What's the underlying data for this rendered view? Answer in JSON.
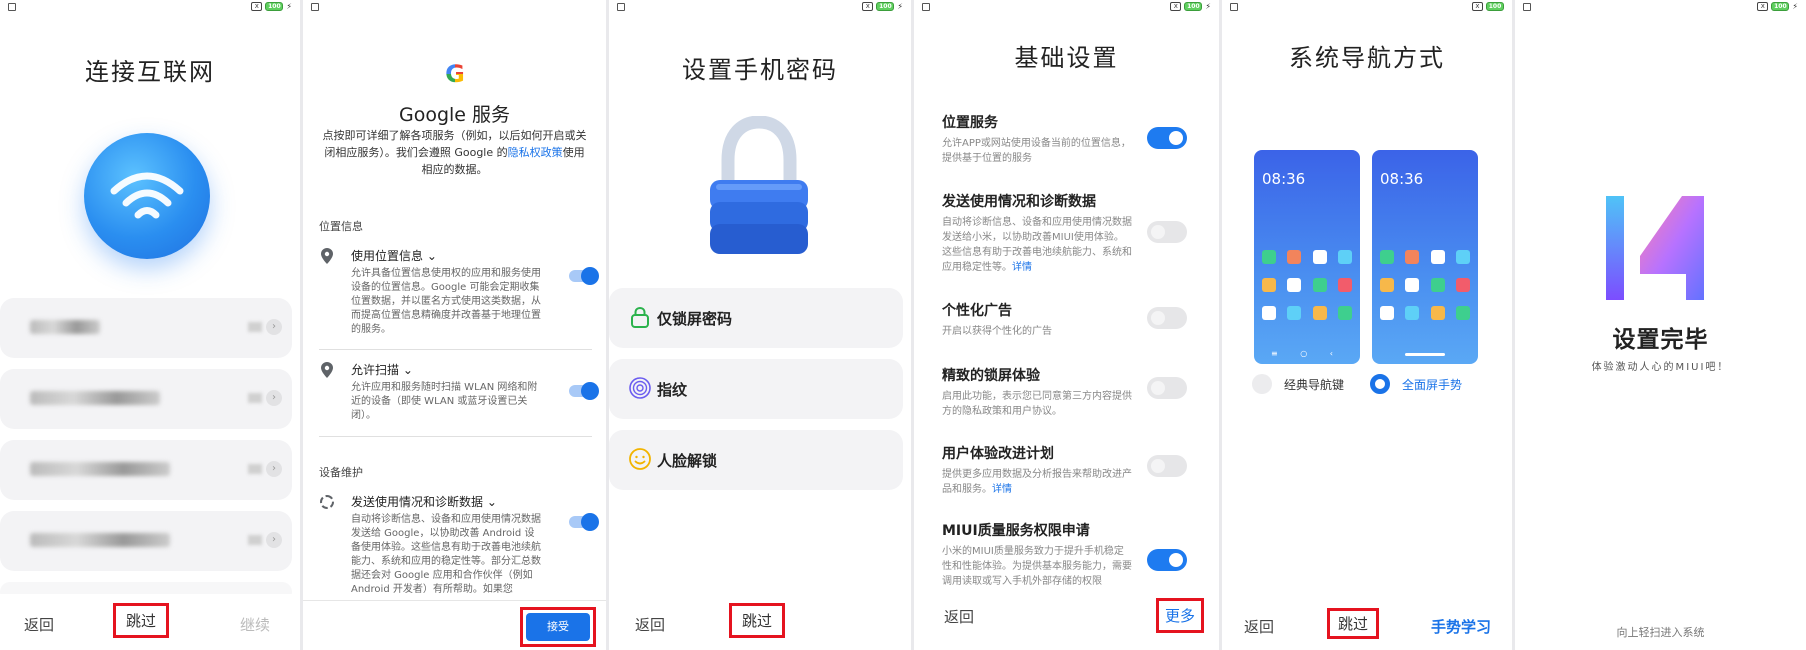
{
  "status": {
    "battery": "100",
    "x_label": "x"
  },
  "wifi_screen": {
    "title": "连接互联网",
    "back": "返回",
    "skip": "跳过",
    "continue": "继续"
  },
  "google_screen": {
    "logo": "G",
    "title": "Google 服务",
    "intro_a": "点按即可详细了解各项服务（例如，以后如何开启或关闭相应服务）。我们会遵照 Google 的",
    "intro_link": "隐私权政策",
    "intro_b": "使用相应的数据。",
    "section_location": "位置信息",
    "item1_title": "使用位置信息",
    "item1_desc": "允许具备位置信息使用权的应用和服务使用设备的位置信息。Google 可能会定期收集位置数据，并以匿名方式使用这类数据，从而提高位置信息精确度并改善基于地理位置的服务。",
    "item2_title": "允许扫描",
    "item2_desc": "允许应用和服务随时扫描 WLAN 网络和附近的设备（即使 WLAN 或蓝牙设置已关闭）。",
    "section_maintenance": "设备维护",
    "item3_title": "发送使用情况和诊断数据",
    "item3_desc": "自动将诊断信息、设备和应用使用情况数据发送给 Google，以协助改善 Android 设备使用体验。这些信息有助于改善电池续航能力、系统和应用的稳定性等。部分汇总数据还会对 Google 应用和合作伙伴（例如 Android 开发者）有所帮助。如果您",
    "accept": "接受"
  },
  "password_screen": {
    "title": "设置手机密码",
    "options": [
      {
        "label": "仅锁屏密码",
        "icon": "lock-outline-icon"
      },
      {
        "label": "指纹",
        "icon": "fingerprint-icon"
      },
      {
        "label": "人脸解锁",
        "icon": "face-smile-icon"
      }
    ],
    "back": "返回",
    "skip": "跳过"
  },
  "basic_screen": {
    "title": "基础设置",
    "items": [
      {
        "title": "位置服务",
        "desc": "允许APP或网站使用设备当前的位置信息，提供基于位置的服务",
        "link": "",
        "on": true
      },
      {
        "title": "发送使用情况和诊断数据",
        "desc": "自动将诊断信息、设备和应用使用情况数据发送给小米，以协助改善MIUI使用体验。这些信息有助于改善电池续航能力、系统和应用稳定性等。",
        "link": "详情",
        "on": false
      },
      {
        "title": "个性化广告",
        "desc": "",
        "link": "开启以获得个性化的广告",
        "on": false
      },
      {
        "title": "精致的锁屏体验",
        "desc": "启用此功能，表示您已同意第三方内容提供方的隐私政策和用户协议。",
        "link": "",
        "on": false
      },
      {
        "title": "用户体验改进计划",
        "desc": "提供更多应用数据及分析报告来帮助改进产品和服务。",
        "link": "详情",
        "on": false
      },
      {
        "title": "MIUI质量服务权限申请",
        "desc": "小米的MIUI质量服务致力于提升手机稳定性和性能体验。为提供基本服务能力，需要调用读取或写入手机外部存储的权限",
        "link": "",
        "on": true
      }
    ],
    "back": "返回",
    "more": "更多"
  },
  "nav_screen": {
    "title": "系统导航方式",
    "phone_time": "08:36",
    "option_classic": "经典导航键",
    "option_gesture": "全面屏手势",
    "back": "返回",
    "skip": "跳过",
    "learn": "手势学习",
    "colors": {
      "accent": "#1a73e8"
    }
  },
  "done_screen": {
    "logo_text": "14",
    "title": "设置完毕",
    "subtitle": "体验激动人心的MIUI吧！",
    "hint": "向上轻扫进入系统"
  }
}
